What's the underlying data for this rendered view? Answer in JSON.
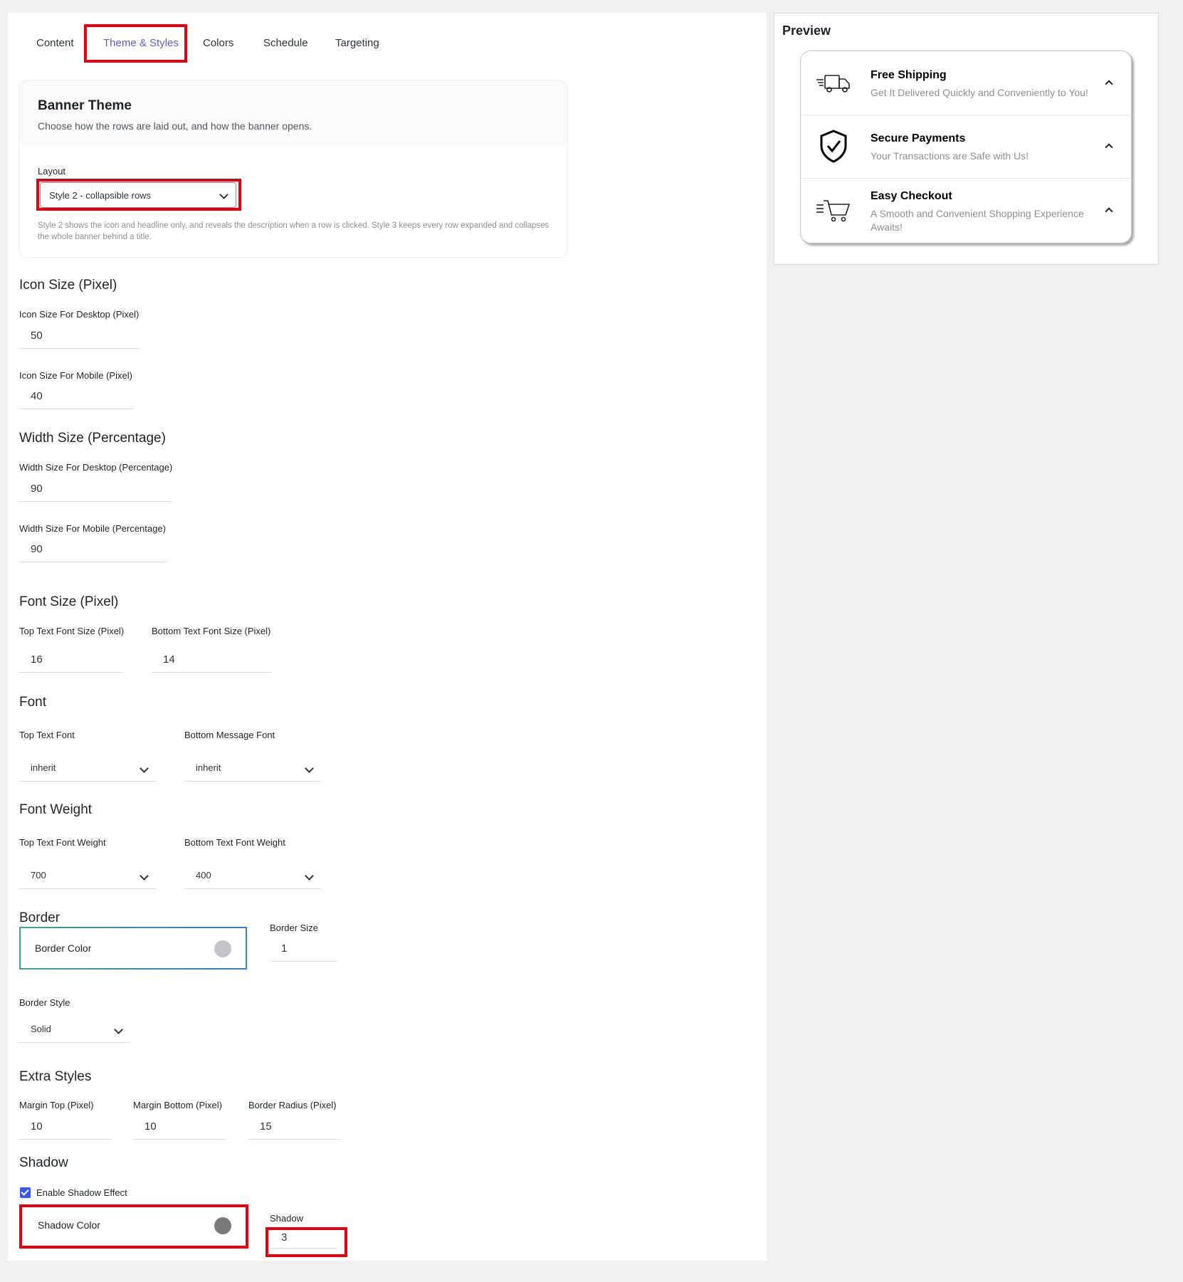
{
  "tabs": [
    "Content",
    "Theme & Styles",
    "Colors",
    "Schedule",
    "Targeting"
  ],
  "active_tab": "Theme & Styles",
  "banner_theme": {
    "title": "Banner Theme",
    "subtitle": "Choose how the rows are laid out, and how the banner opens.",
    "layout_label": "Layout",
    "layout_value": "Style 2 - collapsible rows",
    "help": "Style 2 shows the icon and headline only, and reveals the description when a row is clicked. Style 3 keeps every row expanded and collapses the whole banner behind a title."
  },
  "icon_size": {
    "title": "Icon Size (Pixel)",
    "desktop_label": "Icon Size For Desktop (Pixel)",
    "desktop_value": "50",
    "mobile_label": "Icon Size For Mobile (Pixel)",
    "mobile_value": "40"
  },
  "width_size": {
    "title": "Width Size (Percentage)",
    "desktop_label": "Width Size For Desktop (Percentage)",
    "desktop_value": "90",
    "mobile_label": "Width Size For Mobile (Percentage)",
    "mobile_value": "90"
  },
  "font_size": {
    "title": "Font Size (Pixel)",
    "top_label": "Top Text Font Size (Pixel)",
    "top_value": "16",
    "bottom_label": "Bottom Text Font Size (Pixel)",
    "bottom_value": "14"
  },
  "font": {
    "title": "Font",
    "top_label": "Top Text Font",
    "top_value": "inherit",
    "bottom_label": "Bottom Message Font",
    "bottom_value": "inherit"
  },
  "font_weight": {
    "title": "Font Weight",
    "top_label": "Top Text Font Weight",
    "top_value": "700",
    "bottom_label": "Bottom Text Font Weight",
    "bottom_value": "400"
  },
  "border": {
    "title": "Border",
    "color_label": "Border Color",
    "color": "#c3c4c7",
    "size_label": "Border Size",
    "size_value": "1",
    "style_label": "Border Style",
    "style_value": "Solid"
  },
  "extra_styles": {
    "title": "Extra Styles",
    "margin_top_label": "Margin Top (Pixel)",
    "margin_top_value": "10",
    "margin_bottom_label": "Margin Bottom (Pixel)",
    "margin_bottom_value": "10",
    "radius_label": "Border Radius (Pixel)",
    "radius_value": "15"
  },
  "shadow": {
    "title": "Shadow",
    "enable_label": "Enable Shadow Effect",
    "enabled": true,
    "color_label": "Shadow Color",
    "color": "#7a7a7a",
    "value_label": "Shadow",
    "value": "3"
  },
  "preview": {
    "title": "Preview",
    "rows": [
      {
        "icon": "truck-icon",
        "title": "Free Shipping",
        "desc": "Get It Delivered Quickly and Conveniently to You!"
      },
      {
        "icon": "shield-check-icon",
        "title": "Secure Payments",
        "desc": "Your Transactions are Safe with Us!"
      },
      {
        "icon": "cart-icon",
        "title": "Easy Checkout",
        "desc": "A Smooth and Convenient Shopping Experience Awaits!"
      }
    ]
  },
  "colors": {
    "accent": "#5b5bd6",
    "highlight": "#e1000f",
    "checkbox": "#3858e9"
  }
}
